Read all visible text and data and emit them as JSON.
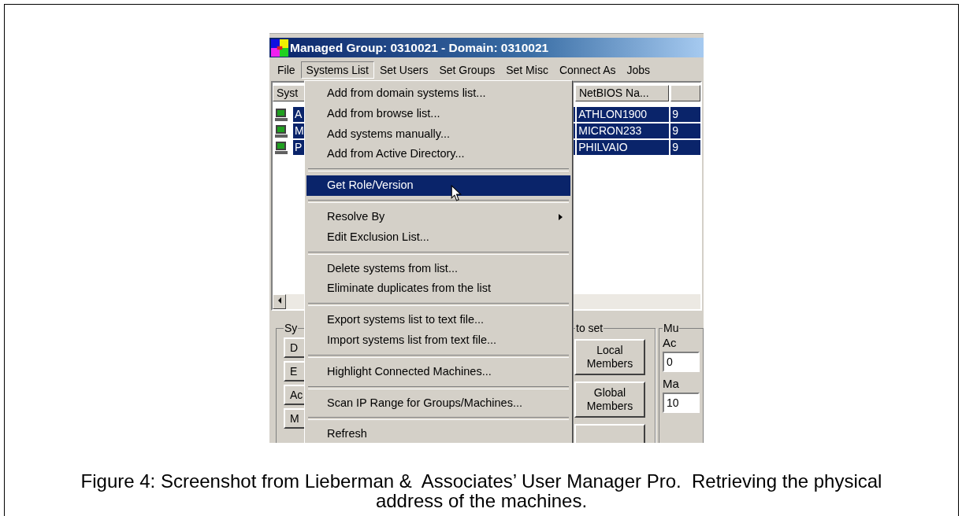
{
  "figure": {
    "window": {
      "title": "Managed Group: 0310021 - Domain: 0310021"
    },
    "menu_bar": [
      {
        "label": "File",
        "selected": false
      },
      {
        "label": "Systems List",
        "selected": true
      },
      {
        "label": "Set Users",
        "selected": false
      },
      {
        "label": "Set Groups",
        "selected": false
      },
      {
        "label": "Set Misc",
        "selected": false
      },
      {
        "label": "Connect As",
        "selected": false
      },
      {
        "label": "Jobs",
        "selected": false
      }
    ],
    "list": {
      "columns": [
        "Syst",
        "NetBIOS Na..."
      ],
      "rows": [
        {
          "cells": [
            "A",
            "ATHLON1900",
            "9"
          ],
          "selected": true
        },
        {
          "cells": [
            "M",
            "MICRON233",
            "9"
          ],
          "selected": true
        },
        {
          "cells": [
            "P",
            "PHILVAIO",
            "9"
          ],
          "selected": true
        }
      ]
    },
    "panel": {
      "groups": [
        {
          "kind": "buttons",
          "title": "Sy",
          "buttons": [
            "D",
            "E",
            "Ac",
            "M"
          ]
        },
        {
          "kind": "pairs",
          "title": "to set",
          "buttons": [
            {
              "kind": "labeled",
              "label": "Local Members"
            },
            {
              "kind": "labeled",
              "label": "Global Members"
            },
            {
              "kind": "blank"
            }
          ]
        },
        {
          "kind": "fields",
          "title": "Mu",
          "fields": [
            {
              "label": "Ac",
              "value": "0"
            },
            {
              "label": "Ma",
              "value": "10"
            }
          ]
        }
      ]
    },
    "dropdown": [
      {
        "kind": "item",
        "label": "Add from domain systems list...",
        "selected": false
      },
      {
        "kind": "item",
        "label": "Add from browse list...",
        "selected": false
      },
      {
        "kind": "item",
        "label": "Add systems manually...",
        "selected": false
      },
      {
        "kind": "item",
        "label": "Add from Active Directory...",
        "selected": false
      },
      {
        "kind": "separator"
      },
      {
        "kind": "item",
        "label": "Get Role/Version",
        "selected": true
      },
      {
        "kind": "separator"
      },
      {
        "kind": "item",
        "label": "Resolve By",
        "selected": false,
        "submenu": true
      },
      {
        "kind": "item",
        "label": "Edit Exclusion List...",
        "selected": false
      },
      {
        "kind": "separator"
      },
      {
        "kind": "item",
        "label": "Delete systems from list...",
        "selected": false
      },
      {
        "kind": "item",
        "label": "Eliminate duplicates from the list",
        "selected": false
      },
      {
        "kind": "separator"
      },
      {
        "kind": "item",
        "label": "Export systems list to text file...",
        "selected": false
      },
      {
        "kind": "item",
        "label": "Import systems list from text file...",
        "selected": false
      },
      {
        "kind": "separator"
      },
      {
        "kind": "item",
        "label": "Highlight Connected Machines...",
        "selected": false
      },
      {
        "kind": "separator"
      },
      {
        "kind": "item",
        "label": "Scan IP Range for Groups/Machines...",
        "selected": false
      },
      {
        "kind": "separator"
      },
      {
        "kind": "item",
        "label": "Refresh",
        "selected": false
      }
    ]
  },
  "caption": "Figure 4: Screenshot from Lieberman &  Associates’ User Manager Pro.  Retrieving the physical address of the machines."
}
